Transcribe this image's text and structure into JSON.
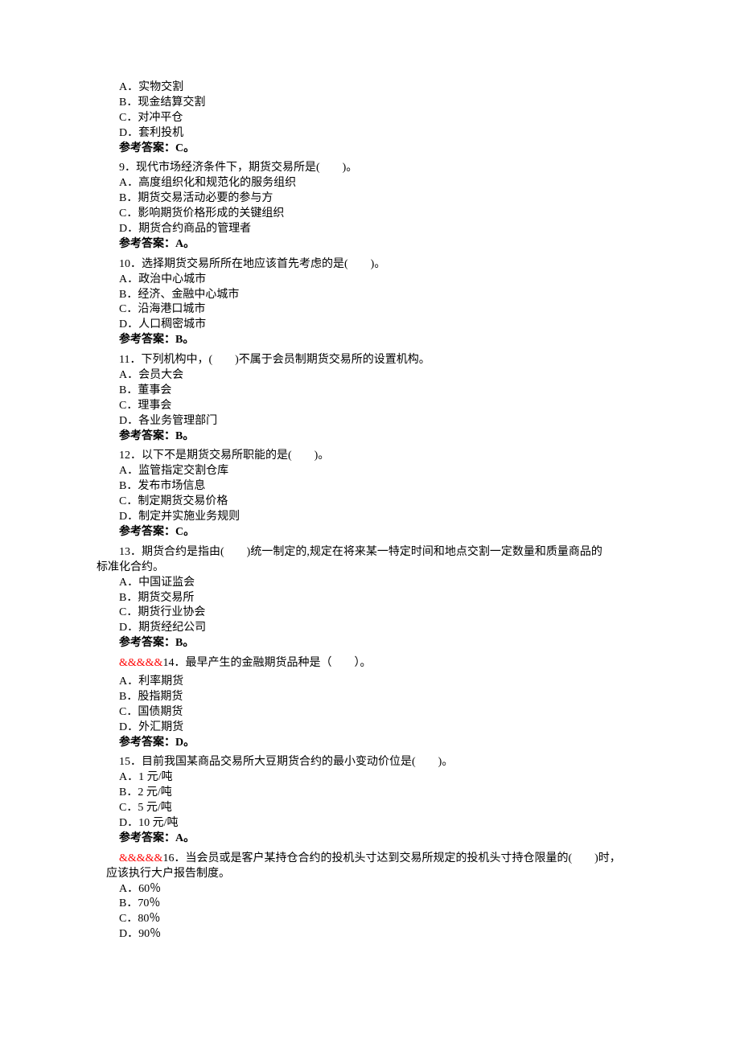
{
  "q8": {
    "A": "A．实物交割",
    "B": "B．现金结算交割",
    "C": "C．对冲平仓",
    "D": "D．套利投机",
    "answer": "参考答案：C。"
  },
  "q9": {
    "stem": "9．现代市场经济条件下，期货交易所是(　　)。",
    "A": "A．高度组织化和规范化的服务组织",
    "B": "B．期货交易活动必要的参与方",
    "C": "C．影响期货价格形成的关键组织",
    "D": "D．期货合约商品的管理者",
    "answer": "参考答案：A。"
  },
  "q10": {
    "stem": "10．选择期货交易所所在地应该首先考虑的是(　　)。",
    "A": "A．政治中心城市",
    "B": "B．经济、金融中心城市",
    "C": "C．沿海港口城市",
    "D": "D．人口稠密城市",
    "answer": "参考答案：B。"
  },
  "q11": {
    "stem": "11．下列机构中，(　　)不属于会员制期货交易所的设置机构。",
    "A": "A．会员大会",
    "B": "B．董事会",
    "C": "C．理事会",
    "D": "D．各业务管理部门",
    "answer": "参考答案：B。"
  },
  "q12": {
    "stem": "12．以下不是期货交易所职能的是(　　)。",
    "A": "A．监管指定交割仓库",
    "B": "B．发布市场信息",
    "C": "C．制定期货交易价格",
    "D": "D．制定并实施业务规则",
    "answer": "参考答案：C。"
  },
  "q13": {
    "stem1": "13．期货合约是指由(　　)统一制定的,规定在将来某一特定时间和地点交割一定数量和质量商品的",
    "stem2": "标准化合约。",
    "A": "A．中国证监会",
    "B": "B．期货交易所",
    "C": "C．期货行业协会",
    "D": "D．期货经纪公司",
    "answer": "参考答案：B。"
  },
  "q14": {
    "marker": "&&&&&",
    "stem": "14．最早产生的金融期货品种是（　　）。",
    "A": "A．利率期货",
    "B": "B．股指期货",
    "C": "C．国债期货",
    "D": "D．外汇期货",
    "answer": "参考答案：D。"
  },
  "q15": {
    "stem": "15．目前我国某商品交易所大豆期货合约的最小变动价位是(　　)。",
    "A": "A．1 元/吨",
    "B": "B．2 元/吨",
    "C": "C．5 元/吨",
    "D": "D．10 元/吨",
    "answer": "参考答案：A。"
  },
  "q16": {
    "marker": "&&&&&",
    "stem1": "16．当会员或是客户某持仓合约的投机头寸达到交易所规定的投机头寸持仓限量的(　　)时，",
    "stem2": "应该执行大户报告制度。",
    "A": "A．60％",
    "B": "B．70％",
    "C": "C．80％",
    "D": "D．90％"
  }
}
